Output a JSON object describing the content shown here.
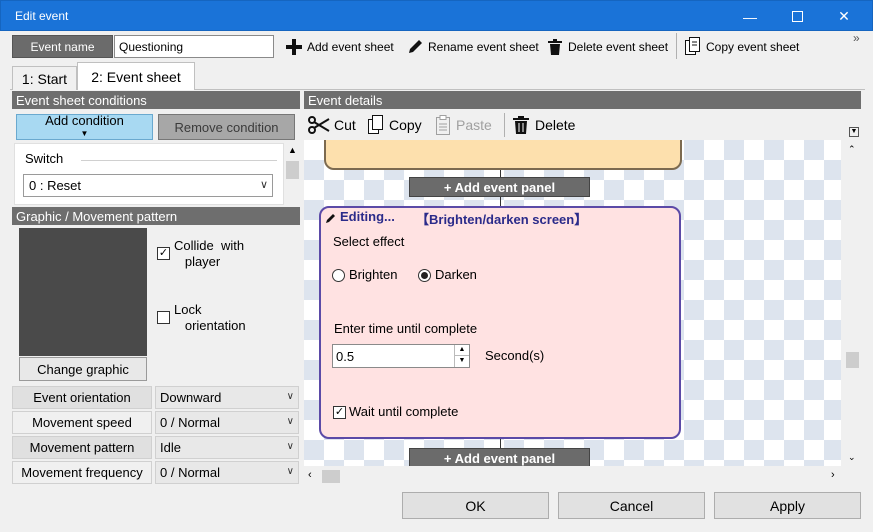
{
  "window": {
    "title": "Edit event"
  },
  "toolbar": {
    "event_name_label": "Event name",
    "event_name_value": "Questioning",
    "add_sheet": "Add event sheet",
    "rename_sheet": "Rename event sheet",
    "delete_sheet": "Delete event sheet",
    "copy_sheet": "Copy event sheet",
    "overflow": "»"
  },
  "tabs": [
    {
      "label": "1: Start"
    },
    {
      "label": "2: Event sheet"
    }
  ],
  "conditions": {
    "header": "Event sheet conditions",
    "add_button": "Add condition",
    "remove_button": "Remove condition",
    "switch_label": "Switch",
    "switch_value": "0 : Reset"
  },
  "graphic": {
    "header": "Graphic / Movement pattern",
    "collide_label": "Collide  with\n   player",
    "collide_checked": true,
    "lock_label": "Lock\n   orientation",
    "lock_checked": false,
    "change_button": "Change graphic"
  },
  "movement": {
    "rows": [
      {
        "label": "Event orientation",
        "value": "Downward"
      },
      {
        "label": "Movement speed",
        "value": "0 / Normal"
      },
      {
        "label": "Movement pattern",
        "value": "Idle"
      },
      {
        "label": "Movement frequency",
        "value": "0 / Normal"
      }
    ]
  },
  "details": {
    "header": "Event details",
    "cut": "Cut",
    "copy": "Copy",
    "paste": "Paste",
    "delete": "Delete",
    "add_panel": "+ Add event panel",
    "editing_title": "Editing...",
    "editing_command": "【Brighten/darken screen】",
    "select_effect": "Select effect",
    "brighten": "Brighten",
    "darken": "Darken",
    "selected_effect": "darken",
    "time_label": "Enter time until complete",
    "time_value": "0.5",
    "time_unit": "Second(s)",
    "wait_label": "Wait until complete",
    "wait_checked": true
  },
  "footer": {
    "ok": "OK",
    "cancel": "Cancel",
    "apply": "Apply"
  },
  "colors": {
    "titlebar": "#1a73d8",
    "section_header": "#6e6e6e",
    "add_condition": "#a8d9f2",
    "editing_panel_bg": "#ffe2e2",
    "editing_panel_border": "#5b4aa7",
    "prev_panel": "#fde0ad"
  }
}
